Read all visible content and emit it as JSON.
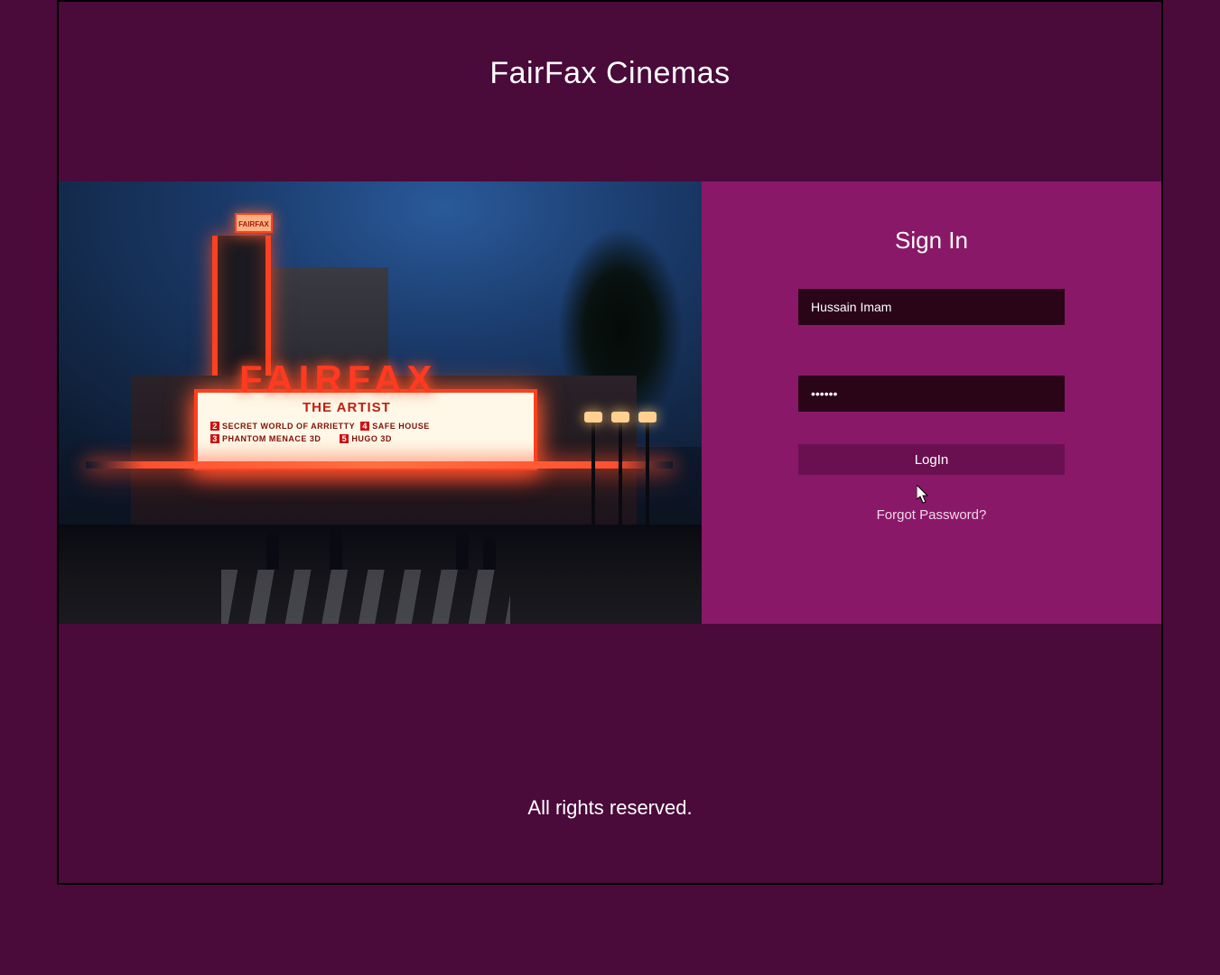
{
  "header": {
    "title": "FairFax Cinemas"
  },
  "hero": {
    "sign_small": "FAIRFAX",
    "sign_large": "FAIRFAX",
    "marquee_feature": "THE ARTIST",
    "marquee_rows": [
      {
        "num1": "2",
        "title1": "SECRET WORLD OF ARRIETTY",
        "num2": "4",
        "title2": "SAFE HOUSE"
      },
      {
        "num1": "3",
        "title1": "PHANTOM MENACE 3D",
        "num2": "5",
        "title2": "HUGO 3D"
      }
    ]
  },
  "signin": {
    "heading": "Sign In",
    "username_value": "Hussain Imam",
    "password_value": "••••••",
    "login_label": "LogIn",
    "forgot_label": "Forgot Password?"
  },
  "footer": {
    "text": "All rights reserved."
  },
  "colors": {
    "page_bg": "#4a0a3a",
    "panel_bg": "#8a1868",
    "field_bg": "#2a0518",
    "button_bg": "#6a1050"
  }
}
